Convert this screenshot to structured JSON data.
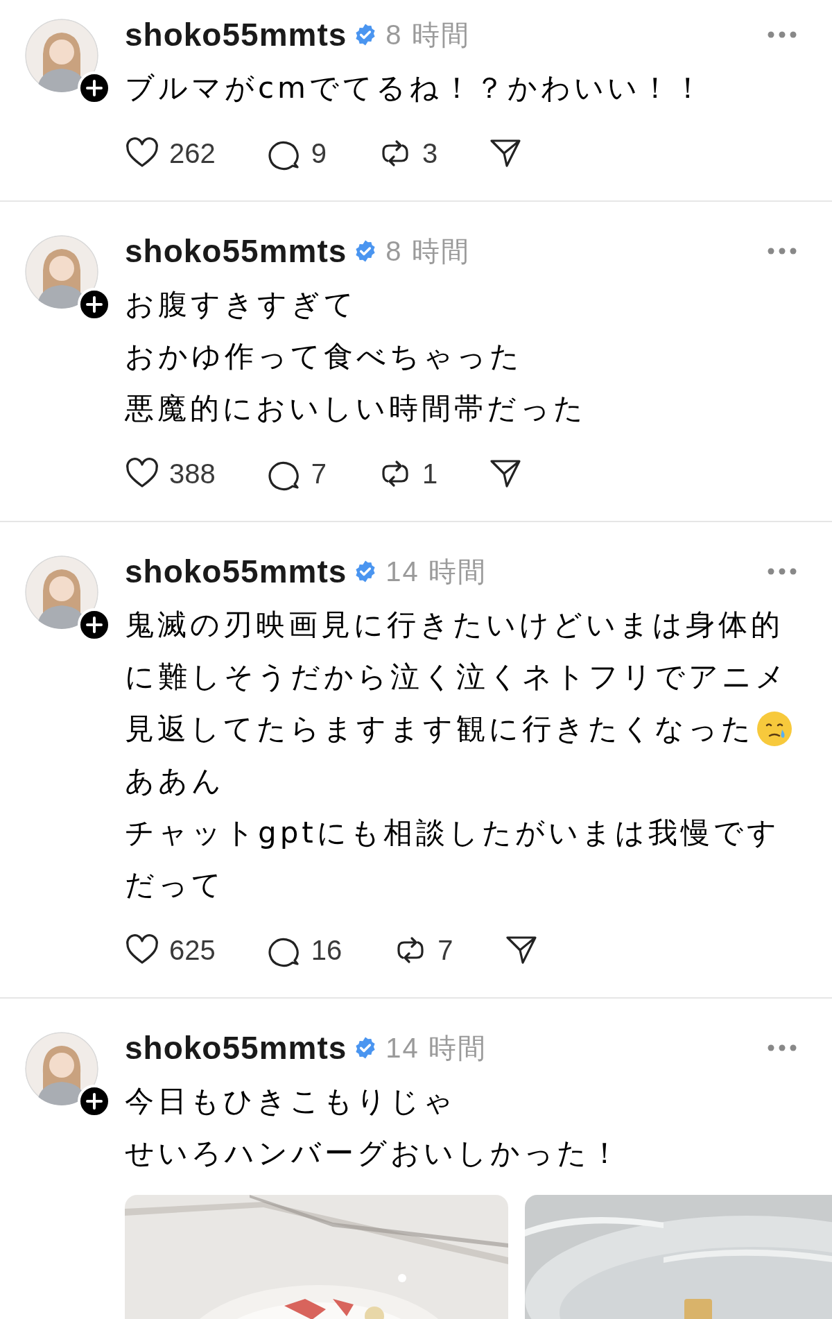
{
  "posts": [
    {
      "username": "shoko55mmts",
      "verified": true,
      "time": "8 時間",
      "lines": [
        {
          "text": "ブルマがcmでてるね！？かわいい！！",
          "emoji": false
        }
      ],
      "likes": "262",
      "replies": "9",
      "reposts": "3"
    },
    {
      "username": "shoko55mmts",
      "verified": true,
      "time": "8 時間",
      "lines": [
        {
          "text": "お腹すきすぎて",
          "emoji": false
        },
        {
          "text": "おかゆ作って食べちゃった",
          "emoji": false
        },
        {
          "text": "悪魔的においしい時間帯だった",
          "emoji": false
        }
      ],
      "likes": "388",
      "replies": "7",
      "reposts": "1"
    },
    {
      "username": "shoko55mmts",
      "verified": true,
      "time": "14 時間",
      "lines": [
        {
          "text": "鬼滅の刃映画見に行きたいけどいまは身体的",
          "emoji": false
        },
        {
          "text": "に難しそうだから泣く泣くネトフリでアニメ",
          "emoji": false
        },
        {
          "text": "見返してたらますます観に行きたくなった",
          "emoji": true
        },
        {
          "text": "ああん",
          "emoji": false
        },
        {
          "text": "チャットgptにも相談したがいまは我慢です",
          "emoji": false
        },
        {
          "text": "だって",
          "emoji": false
        }
      ],
      "likes": "625",
      "replies": "16",
      "reposts": "7"
    },
    {
      "username": "shoko55mmts",
      "verified": true,
      "time": "14 時間",
      "lines": [
        {
          "text": "今日もひきこもりじゃ",
          "emoji": false
        },
        {
          "text": "せいろハンバーグおいしかった！",
          "emoji": false
        }
      ],
      "images": [
        {
          "kind": "picture"
        },
        {
          "kind": "picture"
        }
      ]
    }
  ]
}
